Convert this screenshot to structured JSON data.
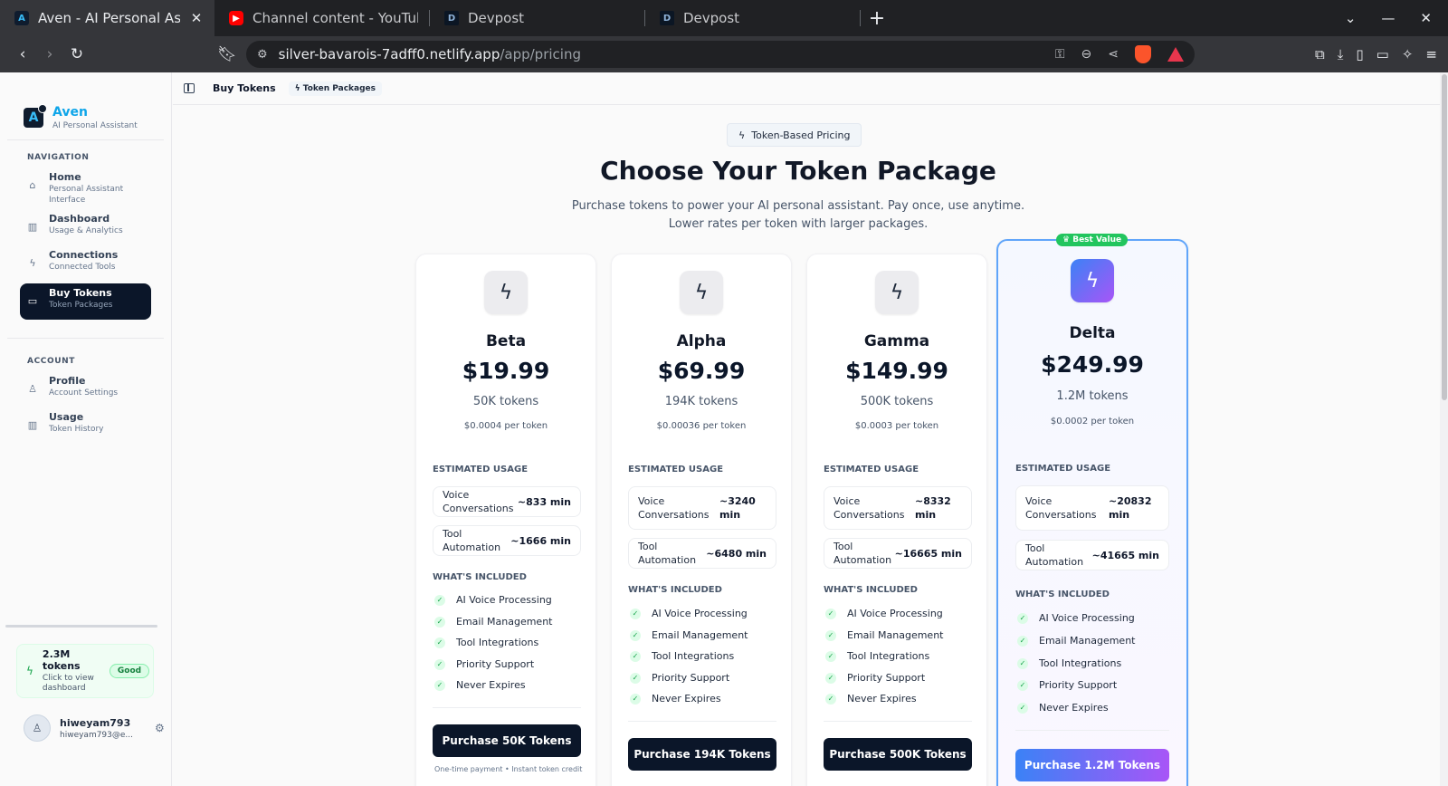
{
  "browser": {
    "tabs": [
      {
        "title": "Aven - AI Personal Assistant",
        "icon": "aven-favicon",
        "active": true
      },
      {
        "title": "Channel content - YouTube Studio",
        "icon": "youtube-favicon"
      },
      {
        "title": "Devpost",
        "icon": "devpost-favicon"
      },
      {
        "title": "Devpost",
        "icon": "devpost-favicon"
      }
    ],
    "url_host": "silver-bavarois-7adff0.netlify.app",
    "url_path": "/app/pricing"
  },
  "sidebar": {
    "brand": {
      "name": "Aven",
      "subtitle": "AI Personal Assistant"
    },
    "navigation_label": "NAVIGATION",
    "nav_items": [
      {
        "title": "Home",
        "subtitle": "Personal Assistant Interface",
        "icon": "home-icon"
      },
      {
        "title": "Dashboard",
        "subtitle": "Usage & Analytics",
        "icon": "bar-chart-icon"
      },
      {
        "title": "Connections",
        "subtitle": "Connected Tools",
        "icon": "zap-icon"
      },
      {
        "title": "Buy Tokens",
        "subtitle": "Token Packages",
        "icon": "credit-card-icon",
        "active": true
      }
    ],
    "account_label": "ACCOUNT",
    "account_items": [
      {
        "title": "Profile",
        "subtitle": "Account Settings",
        "icon": "user-icon"
      },
      {
        "title": "Usage",
        "subtitle": "Token History",
        "icon": "bar-chart-icon"
      }
    ],
    "token_card": {
      "amount": "2.3M tokens",
      "subtitle": "Click to view dashboard",
      "status": "Good"
    },
    "user": {
      "name": "hiweyam793",
      "email": "hiweyam793@e..."
    }
  },
  "topbar": {
    "title": "Buy Tokens",
    "chip": "Token Packages"
  },
  "hero": {
    "pill": "Token-Based Pricing",
    "headline": "Choose Your Token Package",
    "subtext_line1": "Purchase tokens to power your AI personal assistant. Pay once, use anytime.",
    "subtext_line2": "Lower rates per token with larger packages."
  },
  "labels": {
    "estimated_usage": "ESTIMATED USAGE",
    "whats_included": "WHAT'S INCLUDED",
    "voice": "Voice Conversations",
    "tool": "Tool Automation",
    "footnote": "One-time payment • Instant token credit"
  },
  "features": [
    "AI Voice Processing",
    "Email Management",
    "Tool Integrations",
    "Priority Support",
    "Never Expires"
  ],
  "packages": [
    {
      "name": "Beta",
      "price": "$19.99",
      "tokens": "50K tokens",
      "per_token": "$0.0004 per token",
      "voice": "~833 min",
      "tool": "~1666 min",
      "button": "Purchase 50K Tokens"
    },
    {
      "name": "Alpha",
      "price": "$69.99",
      "tokens": "194K tokens",
      "per_token": "$0.00036 per token",
      "voice": "~3240 min",
      "tool": "~6480 min",
      "button": "Purchase 194K Tokens"
    },
    {
      "name": "Gamma",
      "price": "$149.99",
      "tokens": "500K tokens",
      "per_token": "$0.0003 per token",
      "voice": "~8332 min",
      "tool": "~16665 min",
      "button": "Purchase 500K Tokens"
    },
    {
      "name": "Delta",
      "price": "$249.99",
      "tokens": "1.2M tokens",
      "per_token": "$0.0002 per token",
      "voice": "~20832 min",
      "tool": "~41665 min",
      "button": "Purchase 1.2M Tokens",
      "badge": "Best Value"
    }
  ],
  "colors": {
    "accent": "#0ea5e9",
    "dark": "#0b1629",
    "success": "#22c55e",
    "gradient_start": "#3b82f6",
    "gradient_end": "#a855f7"
  }
}
